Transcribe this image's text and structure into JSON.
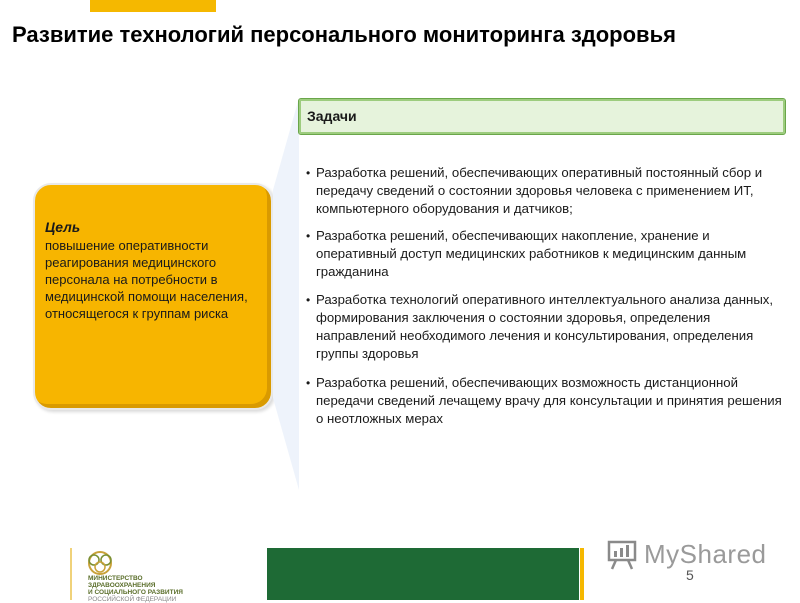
{
  "title": "Развитие технологий персонального мониторинга здоровья",
  "goal": {
    "heading": "Цель",
    "text": "повышение оперативности реагирования медицинского персонала на потребности в медицинской помощи населения, относящегося к группам риска"
  },
  "tasks": {
    "heading": "Задачи",
    "items": [
      "Разработка решений, обеспечивающих оперативный постоянный сбор и передачу сведений о состоянии здоровья человека с применением ИТ, компьютерного оборудования и датчиков;",
      "Разработка решений, обеспечивающих накопление, хранение и оперативный доступ медицинских работников к медицинским данным гражданина",
      "Разработка технологий оперативного интеллектуального анализа данных, формирования заключения о состоянии здоровья, определения направлений необходимого лечения и консультирования, определения группы здоровья",
      "Разработка решений, обеспечивающих возможность дистанционной передачи сведений лечащему врачу для консультации и принятия решения о неотложных мерах"
    ]
  },
  "footer": {
    "logo_lines": [
      "МИНИСТЕРСТВО",
      "ЗДРАВООХРАНЕНИЯ",
      "И СОЦИАЛЬНОГО РАЗВИТИЯ",
      "РОССИЙСКОЙ ФЕДЕРАЦИИ"
    ],
    "watermark": "MyShared",
    "page_number": "5"
  },
  "colors": {
    "accent_yellow": "#f7b500",
    "header_green": "#6aa64a",
    "footer_green": "#1e6a35"
  }
}
